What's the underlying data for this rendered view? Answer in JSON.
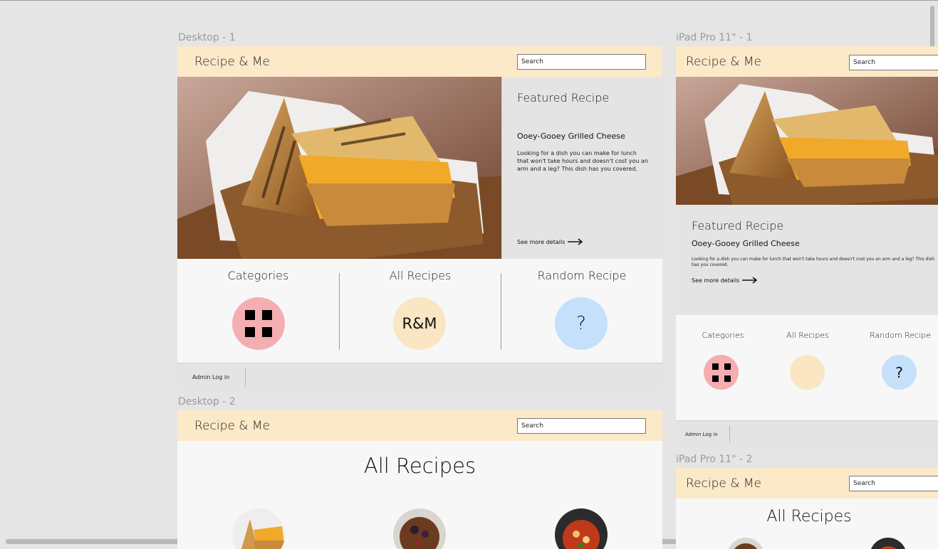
{
  "frames": {
    "desktop1": {
      "label": "Desktop - 1",
      "brand": "Recipe & Me",
      "search_placeholder": "Search",
      "featured": {
        "heading": "Featured Recipe",
        "name": "Ooey-Gooey Grilled Cheese",
        "description": "Looking for a dish you can make for lunch that won't take hours and doesn't cost you an arm and a leg? This dish has you covered.",
        "more_label": "See more details"
      },
      "nav": {
        "categories": "Categories",
        "all_recipes": "All Recipes",
        "all_recipes_badge": "R&M",
        "random_recipe": "Random Recipe",
        "random_badge": "?"
      },
      "footer": {
        "admin_label": "Admin Log in"
      }
    },
    "desktop2": {
      "label": "Desktop - 2",
      "brand": "Recipe & Me",
      "search_placeholder": "Search",
      "page_title": "All Recipes"
    },
    "ipad1": {
      "label": "iPad Pro 11\" - 1",
      "brand": "Recipe & Me",
      "search_placeholder": "Search",
      "featured": {
        "heading": "Featured Recipe",
        "name": "Ooey-Gooey Grilled Cheese",
        "description": "Looking for a dish you can make for lunch that won't take hours and doesn't cost you an arm and a leg? This dish has you covered.",
        "more_label": "See more details"
      },
      "nav": {
        "categories": "Categories",
        "all_recipes": "All Recipes",
        "random_recipe": "Random Recipe",
        "random_badge": "?"
      },
      "footer": {
        "admin_label": "Admin Log in"
      }
    },
    "ipad2": {
      "label": "iPad Pro 11\" - 2",
      "brand": "Recipe & Me",
      "search_placeholder": "Search",
      "page_title": "All Recipes"
    }
  },
  "colors": {
    "header_bg": "#fbe9c8",
    "categories_circle": "#f4aeb0",
    "all_recipes_circle": "#fbe6c4",
    "random_circle": "#c5e0fa",
    "panel_bg": "#e4e4e4"
  },
  "icons": {
    "categories": "grid-icon",
    "see_more": "arrow-right-icon"
  }
}
